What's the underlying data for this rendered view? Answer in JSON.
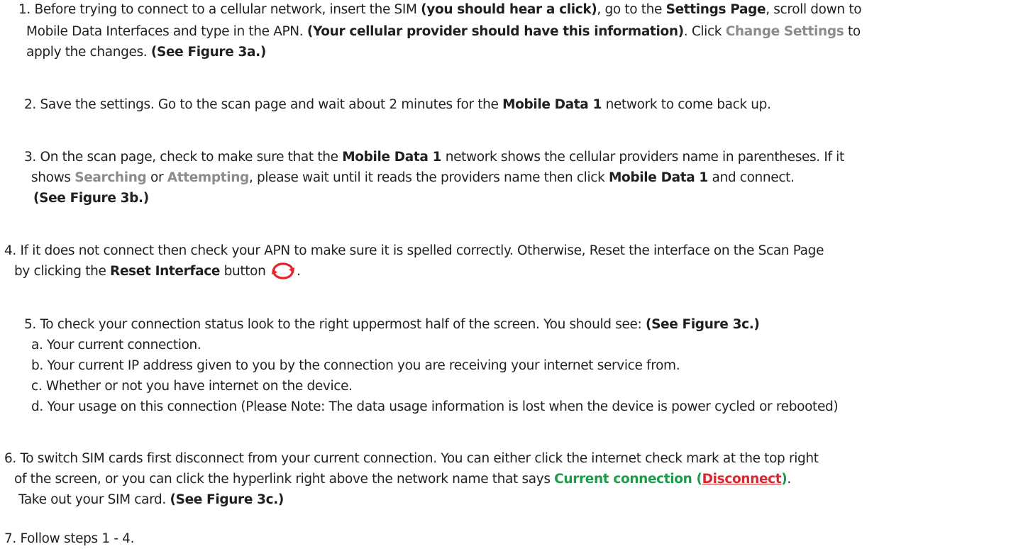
{
  "colors": {
    "text": "#231f20",
    "gray_emphasis": "#8a8c8e",
    "green_link": "#1f9a48",
    "red_link": "#d7282f",
    "icon_red": "#e8232b"
  },
  "s1": {
    "a": "1. Before trying to connect to a cellular network, insert the SIM ",
    "b": "(you should hear a click)",
    "c": ", go to the ",
    "d": "Settings Page",
    "e": ", scroll down to",
    "f": "Mobile Data Interfaces and type in the APN. ",
    "g": "(Your cellular provider should have this information)",
    "h": ". Click ",
    "i": "Change Settings",
    "j": " to",
    "k": "apply the changes. ",
    "l": "(See Figure 3a.)"
  },
  "s2": {
    "a": "2. Save the settings. Go to the scan page and wait about 2 minutes for the ",
    "b": "Mobile Data 1",
    "c": " network to come back up."
  },
  "s3": {
    "a": "3. On the scan page, check to make sure that the ",
    "b": "Mobile Data 1",
    "c": " network shows the cellular providers name in parentheses. If it",
    "d": "shows ",
    "e": "Searching",
    "f": " or ",
    "g": "Attempting",
    "h": ", please wait until it reads the providers name then click ",
    "i": "Mobile Data 1",
    "j": " and connect.",
    "k": "(See Figure 3b.)"
  },
  "s4": {
    "a": "4. If it does not connect then check your APN to make sure it is spelled correctly. Otherwise, Reset the interface on the Scan Page",
    "b": "by clicking the ",
    "c": "Reset Interface",
    "d": " button ",
    "e": "."
  },
  "s5": {
    "a": "5. To check your connection status look to the right uppermost half of the screen. You should see: ",
    "b": "(See Figure 3c.)",
    "items": [
      "a. Your current connection.",
      "b. Your current IP address given to you by the connection you are receiving your internet service from.",
      "c. Whether or not you have internet on the device.",
      "d. Your usage on this connection (Please Note: The data usage information is lost when the device is power cycled or rebooted)"
    ]
  },
  "s6": {
    "a": "6. To switch SIM cards first disconnect from your current connection. You can either click the internet check mark at the top right",
    "b": "of the screen, or you can click the hyperlink right above the network name that says ",
    "c": "Current connection",
    "d": " (",
    "e": "Disconnect",
    "f": ")",
    "g": ".",
    "h": "Take out your SIM card. ",
    "i": "(See Figure 3c.)"
  },
  "s7": {
    "a": "7. Follow steps 1 - 4."
  }
}
